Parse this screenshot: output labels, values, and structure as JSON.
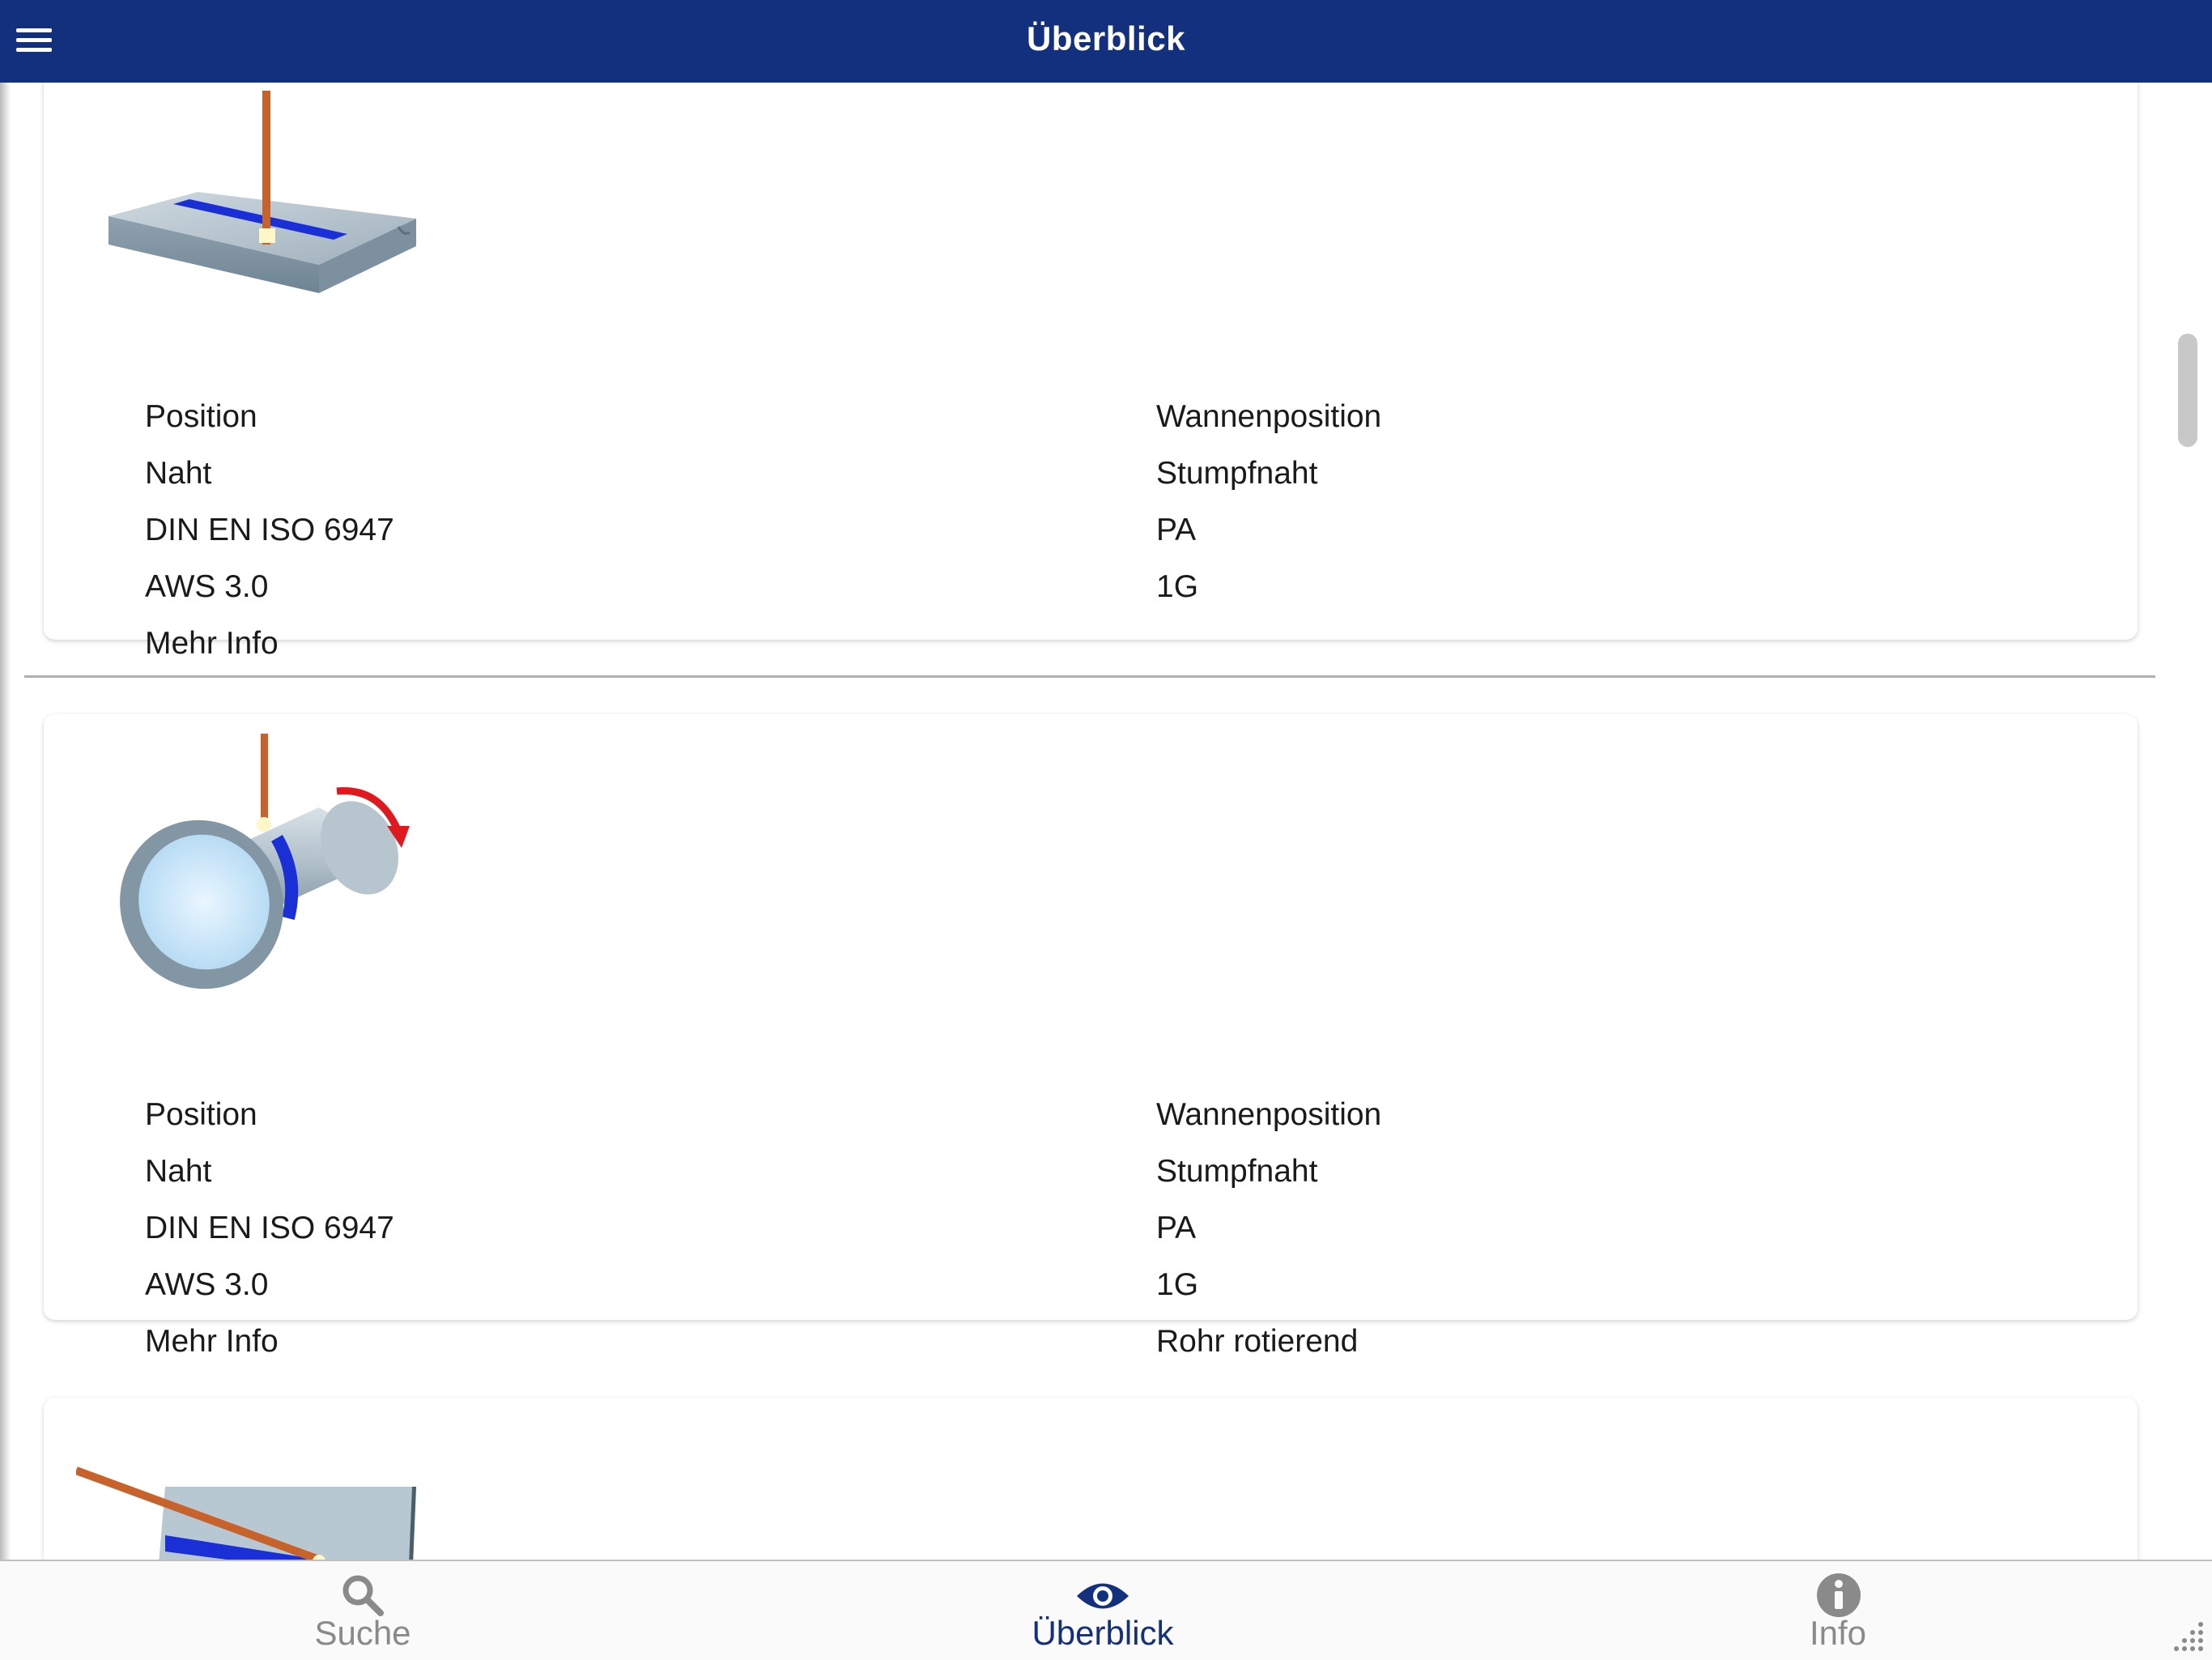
{
  "header": {
    "title": "Überblick",
    "menu_icon": "menu-icon"
  },
  "cards": [
    {
      "image": "flat-plate-butt-weld",
      "rows": [
        {
          "label": "Position",
          "value": "Wannenposition"
        },
        {
          "label": "Naht",
          "value": "Stumpfnaht"
        },
        {
          "label": "DIN EN ISO 6947",
          "value": "PA"
        },
        {
          "label": "AWS 3.0",
          "value": "1G"
        },
        {
          "label": "Mehr Info",
          "value": ""
        }
      ]
    },
    {
      "image": "rotating-pipe-butt-weld",
      "rows": [
        {
          "label": "Position",
          "value": "Wannenposition"
        },
        {
          "label": "Naht",
          "value": "Stumpfnaht"
        },
        {
          "label": "DIN EN ISO 6947",
          "value": "PA"
        },
        {
          "label": "AWS 3.0",
          "value": "1G"
        },
        {
          "label": "Mehr Info",
          "value": "Rohr rotierend"
        }
      ]
    },
    {
      "image": "fillet-weld-plates"
    }
  ],
  "tabs": [
    {
      "label": "Suche",
      "icon": "search-icon",
      "active": false
    },
    {
      "label": "Überblick",
      "icon": "eye-icon",
      "active": true
    },
    {
      "label": "Info",
      "icon": "info-icon",
      "active": false
    }
  ],
  "colors": {
    "header": "#13307e",
    "active_tab": "#13307e",
    "inactive_tab": "#8a8a8a",
    "weld_seam": "#1a2fd6",
    "electrode": "#c8622b"
  }
}
